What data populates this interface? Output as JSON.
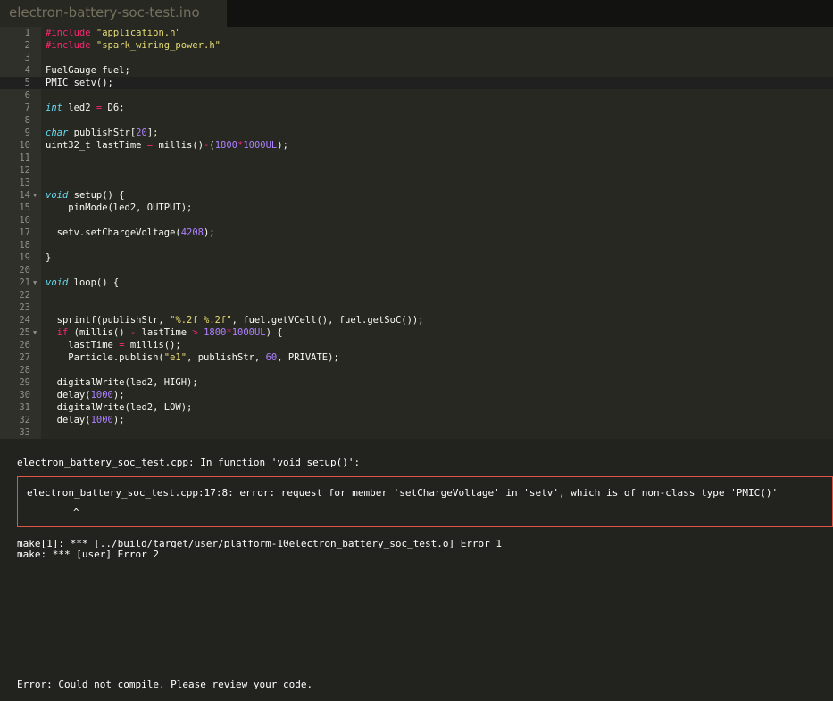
{
  "tab": {
    "filename": "electron-battery-soc-test.ino"
  },
  "editor": {
    "active_line": 5,
    "lines": [
      {
        "n": "1",
        "tokens": [
          {
            "t": "pp",
            "v": "#include "
          },
          {
            "t": "str",
            "v": "\"application.h\""
          }
        ]
      },
      {
        "n": "2",
        "tokens": [
          {
            "t": "pp",
            "v": "#include "
          },
          {
            "t": "str",
            "v": "\"spark_wiring_power.h\""
          }
        ]
      },
      {
        "n": "3",
        "tokens": []
      },
      {
        "n": "4",
        "tokens": [
          {
            "t": "pl",
            "v": "FuelGauge fuel;"
          }
        ]
      },
      {
        "n": "5",
        "tokens": [
          {
            "t": "pl",
            "v": "PMIC setv();"
          }
        ]
      },
      {
        "n": "6",
        "tokens": []
      },
      {
        "n": "7",
        "tokens": [
          {
            "t": "kw",
            "v": "int"
          },
          {
            "t": "pl",
            "v": " led2 "
          },
          {
            "t": "op",
            "v": "="
          },
          {
            "t": "pl",
            "v": " D6;"
          }
        ]
      },
      {
        "n": "8",
        "tokens": []
      },
      {
        "n": "9",
        "tokens": [
          {
            "t": "kw",
            "v": "char"
          },
          {
            "t": "pl",
            "v": " publishStr["
          },
          {
            "t": "num",
            "v": "20"
          },
          {
            "t": "pl",
            "v": "];"
          }
        ]
      },
      {
        "n": "10",
        "tokens": [
          {
            "t": "pl",
            "v": "uint32_t lastTime "
          },
          {
            "t": "op",
            "v": "="
          },
          {
            "t": "pl",
            "v": " millis()"
          },
          {
            "t": "op",
            "v": "-"
          },
          {
            "t": "pl",
            "v": "("
          },
          {
            "t": "num",
            "v": "1800"
          },
          {
            "t": "op",
            "v": "*"
          },
          {
            "t": "num",
            "v": "1000UL"
          },
          {
            "t": "pl",
            "v": ");"
          }
        ]
      },
      {
        "n": "11",
        "tokens": []
      },
      {
        "n": "12",
        "tokens": []
      },
      {
        "n": "13",
        "tokens": []
      },
      {
        "n": "14",
        "fold": true,
        "tokens": [
          {
            "t": "kw",
            "v": "void"
          },
          {
            "t": "pl",
            "v": " setup() {"
          }
        ]
      },
      {
        "n": "15",
        "tokens": [
          {
            "t": "pl",
            "v": "    pinMode(led2, OUTPUT);"
          }
        ]
      },
      {
        "n": "16",
        "tokens": []
      },
      {
        "n": "17",
        "tokens": [
          {
            "t": "pl",
            "v": "  setv.setChargeVoltage("
          },
          {
            "t": "num",
            "v": "4208"
          },
          {
            "t": "pl",
            "v": ");"
          }
        ]
      },
      {
        "n": "18",
        "tokens": []
      },
      {
        "n": "19",
        "tokens": [
          {
            "t": "pl",
            "v": "}"
          }
        ]
      },
      {
        "n": "20",
        "tokens": []
      },
      {
        "n": "21",
        "fold": true,
        "tokens": [
          {
            "t": "kw",
            "v": "void"
          },
          {
            "t": "pl",
            "v": " loop() {"
          }
        ]
      },
      {
        "n": "22",
        "tokens": []
      },
      {
        "n": "23",
        "tokens": []
      },
      {
        "n": "24",
        "tokens": [
          {
            "t": "pl",
            "v": "  sprintf(publishStr, "
          },
          {
            "t": "str",
            "v": "\"%.2f %.2f\""
          },
          {
            "t": "pl",
            "v": ", fuel.getVCell(), fuel.getSoC());"
          }
        ]
      },
      {
        "n": "25",
        "fold": true,
        "tokens": [
          {
            "t": "pl",
            "v": "  "
          },
          {
            "t": "op",
            "v": "if"
          },
          {
            "t": "pl",
            "v": " (millis() "
          },
          {
            "t": "op",
            "v": "-"
          },
          {
            "t": "pl",
            "v": " lastTime "
          },
          {
            "t": "op",
            "v": ">"
          },
          {
            "t": "pl",
            "v": " "
          },
          {
            "t": "num",
            "v": "1800"
          },
          {
            "t": "op",
            "v": "*"
          },
          {
            "t": "num",
            "v": "1000UL"
          },
          {
            "t": "pl",
            "v": ") {"
          }
        ]
      },
      {
        "n": "26",
        "tokens": [
          {
            "t": "pl",
            "v": "    lastTime "
          },
          {
            "t": "op",
            "v": "="
          },
          {
            "t": "pl",
            "v": " millis();"
          }
        ]
      },
      {
        "n": "27",
        "tokens": [
          {
            "t": "pl",
            "v": "    Particle.publish("
          },
          {
            "t": "str",
            "v": "\"e1\""
          },
          {
            "t": "pl",
            "v": ", publishStr, "
          },
          {
            "t": "num",
            "v": "60"
          },
          {
            "t": "pl",
            "v": ", PRIVATE);"
          }
        ]
      },
      {
        "n": "28",
        "tokens": []
      },
      {
        "n": "29",
        "tokens": [
          {
            "t": "pl",
            "v": "  digitalWrite(led2, HIGH);"
          }
        ]
      },
      {
        "n": "30",
        "tokens": [
          {
            "t": "pl",
            "v": "  delay("
          },
          {
            "t": "num",
            "v": "1000"
          },
          {
            "t": "pl",
            "v": ");"
          }
        ]
      },
      {
        "n": "31",
        "tokens": [
          {
            "t": "pl",
            "v": "  digitalWrite(led2, LOW);"
          }
        ]
      },
      {
        "n": "32",
        "tokens": [
          {
            "t": "pl",
            "v": "  delay("
          },
          {
            "t": "num",
            "v": "1000"
          },
          {
            "t": "pl",
            "v": ");"
          }
        ]
      },
      {
        "n": "33",
        "tokens": []
      }
    ]
  },
  "console": {
    "header": "electron_battery_soc_test.cpp: In function 'void setup()':",
    "error_message": "electron_battery_soc_test.cpp:17:8: error: request for member 'setChargeVoltage' in 'setv', which is of non-class type 'PMIC()'",
    "error_caret": "^",
    "make_line_1": "make[1]: *** [../build/target/user/platform-10electron_battery_soc_test.o] Error 1",
    "make_line_2": "make: *** [user] Error 2",
    "final_status": "Error: Could not compile. Please review your code."
  },
  "colors": {
    "editor_bg": "#272822",
    "gutter_bg": "#2f3029",
    "console_bg": "#22221f",
    "error_border": "#e05548",
    "keyword": "#66d9ef",
    "preprocessor": "#f92672",
    "string": "#e6db74",
    "number": "#ae81ff"
  }
}
